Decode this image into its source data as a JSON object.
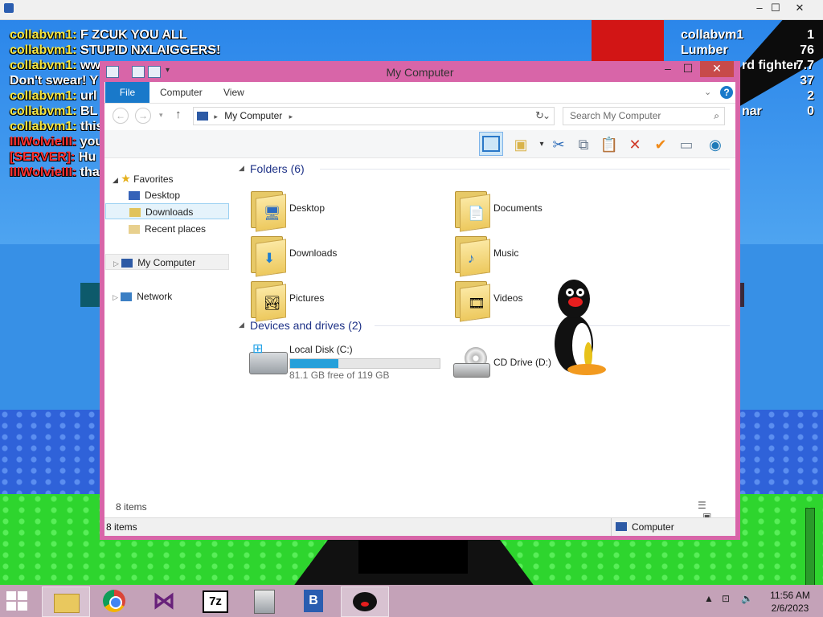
{
  "game": {
    "chat": [
      {
        "user": "collabvm1:",
        "msg": " F ZCUK YOU ALL",
        "user_class": ""
      },
      {
        "user": "collabvm1:",
        "msg": " STUPID NXLAIGGERS!",
        "user_class": ""
      },
      {
        "user": "collabvm1:",
        "msg": " ww",
        "user_class": ""
      },
      {
        "user": "",
        "msg": "Don't swear! Y",
        "user_class": ""
      },
      {
        "user": "collabvm1:",
        "msg": " url",
        "user_class": ""
      },
      {
        "user": "collabvm1:",
        "msg": " BL",
        "user_class": ""
      },
      {
        "user": "collabvm1:",
        "msg": " this",
        "user_class": ""
      },
      {
        "user": "IIIWolvieIII:",
        "msg": " you",
        "user_class": ""
      },
      {
        "user": "[SERVER]:",
        "msg": " Hu",
        "user_class": "red"
      },
      {
        "user": "IIIWolvieIII:",
        "msg": " that",
        "user_class": ""
      }
    ],
    "scores": [
      {
        "name": "collabvm1",
        "value": "1"
      },
      {
        "name": "Lumber",
        "value": "76"
      },
      {
        "name": "rd fighter",
        "value": "7.7"
      },
      {
        "name": "",
        "value": "37"
      },
      {
        "name": "",
        "value": "2"
      },
      {
        "name": "nar",
        "value": "0"
      }
    ]
  },
  "window": {
    "title": "My Computer",
    "tabs": [
      "File",
      "Computer",
      "View"
    ],
    "help": "?",
    "address": "My Computer",
    "search_placeholder": "Search My Computer",
    "nav": {
      "favorites": "Favorites",
      "desktop": "Desktop",
      "downloads": "Downloads",
      "recent": "Recent places",
      "computer": "My Computer",
      "network": "Network"
    },
    "folders_header": "Folders (6)",
    "folders": [
      {
        "label": "Desktop",
        "badge": "🖥"
      },
      {
        "label": "Documents",
        "badge": "📄"
      },
      {
        "label": "Downloads",
        "badge": "⬇"
      },
      {
        "label": "Music",
        "badge": "♪"
      },
      {
        "label": "Pictures",
        "badge": "🏞"
      },
      {
        "label": "Videos",
        "badge": "🎞"
      }
    ],
    "devices_header": "Devices and drives (2)",
    "local_disk": {
      "label": "Local Disk (C:)",
      "free": "81.1 GB free of 119 GB",
      "used_fraction": 0.32
    },
    "cd_drive": {
      "label": "CD Drive (D:)"
    },
    "items_count": "8 items",
    "status_left": "8 items",
    "status_right": "Computer"
  },
  "taskbar": {
    "clock_time": "11:56 AM",
    "clock_date": "2/6/2023",
    "apps": [
      "file-explorer",
      "chrome",
      "visual-studio",
      "7zip",
      "installer",
      "roblox",
      "pingu"
    ]
  },
  "colors": {
    "window_frame": "#d865a8",
    "file_tab": "#1979ca",
    "taskbar": "#c4a2b8"
  }
}
